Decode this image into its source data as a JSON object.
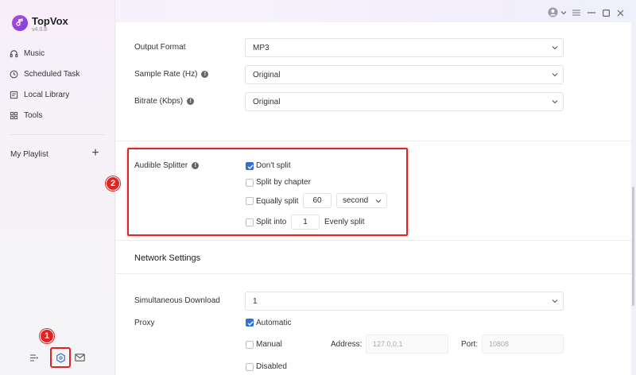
{
  "app": {
    "name": "TopVox",
    "version": "v4.0.8"
  },
  "sidebar": {
    "items": [
      {
        "label": "Music",
        "icon": "headphones-icon"
      },
      {
        "label": "Scheduled Task",
        "icon": "clock-icon"
      },
      {
        "label": "Local Library",
        "icon": "folder-icon"
      },
      {
        "label": "Tools",
        "icon": "grid-icon"
      }
    ],
    "playlist_label": "My Playlist",
    "playlist_add": "+"
  },
  "badges": {
    "one": "1",
    "two": "2"
  },
  "settings": {
    "output_format": {
      "label": "Output Format",
      "value": "MP3"
    },
    "sample_rate": {
      "label": "Sample Rate (Hz)",
      "value": "Original"
    },
    "bitrate": {
      "label": "Bitrate (Kbps)",
      "value": "Original"
    },
    "audible_splitter": {
      "label": "Audible Splitter",
      "dont_split": "Don't split",
      "split_by_chapter": "Split by chapter",
      "equally_split": "Equally split",
      "equally_value": "60",
      "equally_unit": "second",
      "split_into": "Split into",
      "split_into_value": "1",
      "evenly_split": "Evenly split"
    },
    "network_title": "Network Settings",
    "simultaneous": {
      "label": "Simultaneous Download",
      "value": "1"
    },
    "proxy": {
      "label": "Proxy",
      "automatic": "Automatic",
      "manual": "Manual",
      "address_label": "Address:",
      "address_value": "127.0.0.1",
      "port_label": "Port:",
      "port_value": "10808",
      "disabled": "Disabled"
    }
  },
  "colors": {
    "accent": "#2f6fd6",
    "highlight": "#e02424",
    "brand": "#9b46d8"
  }
}
